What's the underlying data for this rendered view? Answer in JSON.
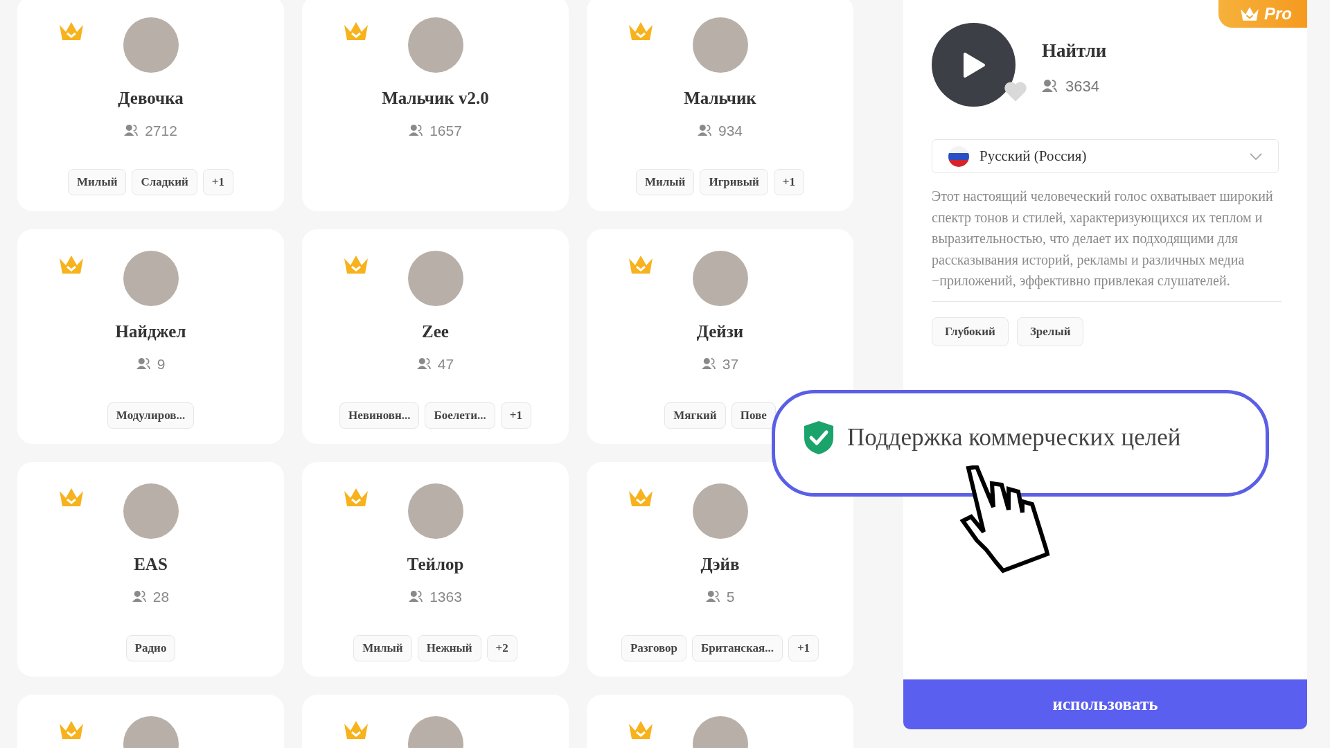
{
  "voices": [
    {
      "name": "Девочка",
      "count": "2712",
      "pro": true,
      "tags": [
        "Милый",
        "Сладкий",
        "+1"
      ]
    },
    {
      "name": "Мальчик v2.0",
      "count": "1657",
      "pro": true
    },
    {
      "name": "Мальчик",
      "count": "934",
      "pro": true,
      "tags": [
        "Милый",
        "Игривый",
        "+1"
      ]
    },
    {
      "name": "Найджел",
      "count": "9",
      "pro": true,
      "tags": [
        "Модулиров..."
      ]
    },
    {
      "name": "Zee",
      "count": "47",
      "pro": true,
      "tags": [
        "Невиновн...",
        "Боелети...",
        "+1"
      ]
    },
    {
      "name": "Дейзи",
      "count": "37",
      "pro": true,
      "tags": [
        "Мягкий",
        "Пове"
      ]
    },
    {
      "name": "EAS",
      "count": "28",
      "pro": true,
      "tags": [
        "Радио"
      ]
    },
    {
      "name": "Тейлор",
      "count": "1363",
      "pro": true,
      "tags": [
        "Милый",
        "Нежный",
        "+2"
      ]
    },
    {
      "name": "Дэйв",
      "count": "5",
      "pro": true,
      "tags": [
        "Разговор",
        "Британская...",
        "+1"
      ]
    },
    {
      "pro": true
    },
    {
      "pro": true
    },
    {
      "pro": true
    }
  ],
  "detail": {
    "badge": "Pro",
    "name": "Найтли",
    "count": "3634",
    "favorite": false,
    "language": "Русский (Россия)",
    "description": "Этот настоящий человеческий голос охватывает широкий спектр тонов и стилей, характеризующихся их теплом и выразительностью, что делает их подходящими для рассказывания историй, рекламы и различных медиа −приложений, эффективно привлекая слушателей.",
    "tags": [
      "Глубокий",
      "Зрелый"
    ],
    "button": "использовать"
  },
  "callout": {
    "text": "Поддержка коммерческих целей"
  }
}
